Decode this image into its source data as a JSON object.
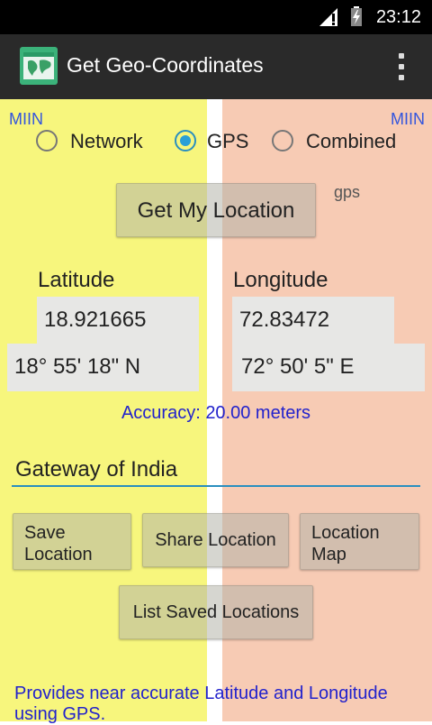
{
  "status_bar": {
    "time": "23:12"
  },
  "action_bar": {
    "title": "Get Geo-Coordinates"
  },
  "labels": {
    "miin_left": "MIIN",
    "miin_right": "MIIN"
  },
  "provider": {
    "options": [
      "Network",
      "GPS",
      "Combined"
    ],
    "selected": "GPS"
  },
  "buttons": {
    "get_location": "Get My Location",
    "save_location": "Save Location",
    "share_location": "Share Location",
    "location_map": "Location Map",
    "list_saved": "List Saved Locations"
  },
  "provider_tag": "gps",
  "latitude": {
    "heading": "Latitude",
    "decimal": "18.921665",
    "dms": "18° 55' 18\" N"
  },
  "longitude": {
    "heading": "Longitude",
    "decimal": "72.83472",
    "dms": "72° 50' 5\" E"
  },
  "accuracy": "Accuracy: 20.00 meters",
  "location_name": {
    "value": "Gateway of India"
  },
  "footer": "Provides near accurate Latitude and Longitude using GPS.",
  "colors": {
    "left_panel": "#f7f67d",
    "right_panel": "#f7cbb4",
    "accent": "#2a9fd6",
    "link_text": "#2222cc"
  }
}
